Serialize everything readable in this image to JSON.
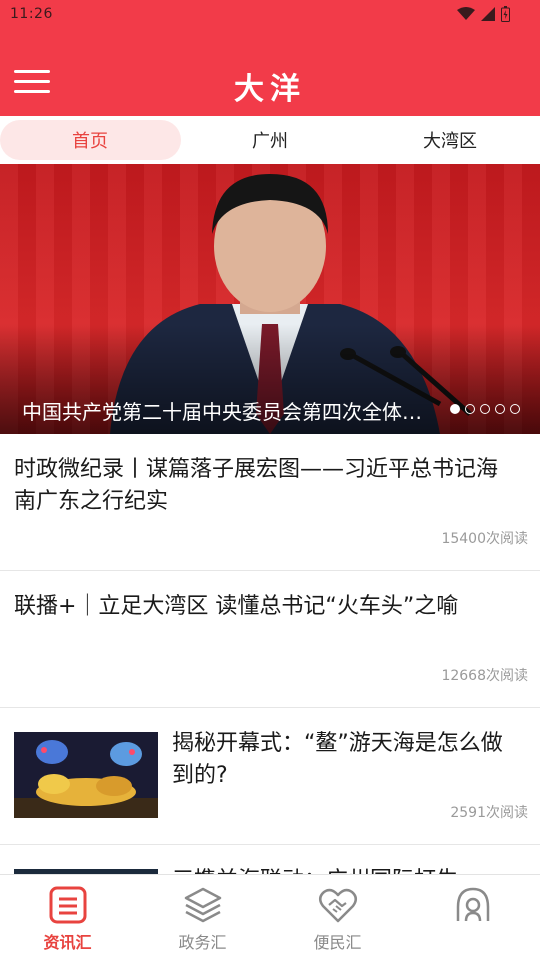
{
  "status": {
    "time": "11:26"
  },
  "header": {
    "title": "大洋"
  },
  "tabs": [
    {
      "label": "首页",
      "active": true
    },
    {
      "label": "广州",
      "active": false
    },
    {
      "label": "大湾区",
      "active": false
    }
  ],
  "banner": {
    "caption": "中国共产党第二十届中央委员会第四次全体会议",
    "slide_count": 5,
    "active_slide": 1
  },
  "articles": [
    {
      "title": "时政微纪录丨谋篇落子展宏图——习近平总书记海南广东之行纪实",
      "reads": "15400次阅读"
    },
    {
      "title": "联播+｜立足大湾区 读懂总书记“火车头”之喻",
      "reads": "12668次阅读"
    },
    {
      "title": "揭秘开幕式：“鳌”游天海是怎么做到的?",
      "reads": "2591次阅读"
    },
    {
      "title": "三携并海联动：广州国际打生"
    }
  ],
  "bottom_nav": [
    {
      "label": "资讯汇",
      "icon": "news-list-icon",
      "active": true
    },
    {
      "label": "政务汇",
      "icon": "layers-icon",
      "active": false
    },
    {
      "label": "便民汇",
      "icon": "handshake-heart-icon",
      "active": false
    },
    {
      "label": "",
      "icon": "user-circle-icon",
      "active": false
    }
  ],
  "colors": {
    "brand": "#f23b49",
    "accent": "#e8433f",
    "tab_active_bg": "#fde7e7"
  }
}
